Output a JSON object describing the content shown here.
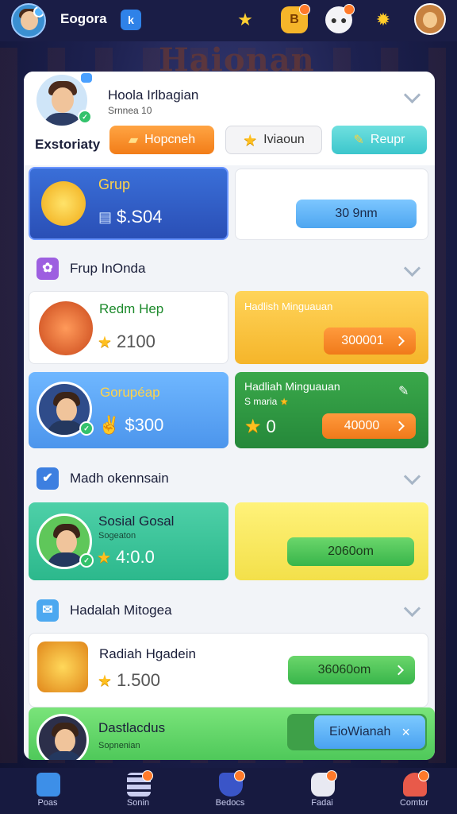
{
  "topbar": {
    "brand": "Eogora",
    "brand_badge": "k",
    "icons": [
      "star-icon",
      "bag-icon",
      "mascot-icon",
      "gear-icon"
    ],
    "accent": "#1a1d46"
  },
  "background_word": "Haionan",
  "profile": {
    "name": "Hoola Irlbagian",
    "subtitle": "Srnnea 10",
    "label": "Exstoriaty",
    "buttons": [
      {
        "label": "Hopcneh",
        "icon": "ticket-icon"
      },
      {
        "label": "Iviaoun",
        "icon": "star-icon"
      },
      {
        "label": "Reupr",
        "icon": "pencil-icon"
      }
    ]
  },
  "group_card": {
    "title": "Grup",
    "amount": "$.S04",
    "side_button": "30 9nm"
  },
  "section1": {
    "title": "Frup InOnda",
    "items": [
      {
        "title": "Redm Hep",
        "value": "2100"
      },
      {
        "title": "Hadlish Minguauan",
        "button": "300001"
      },
      {
        "title": "Gorupéap",
        "amount": "$300"
      },
      {
        "title": "Hadliah Minguauan",
        "sub": "S maria",
        "value": "0",
        "button": "40000"
      }
    ]
  },
  "section2": {
    "title": "Madh okennsain",
    "item": {
      "title": "Sosial Gosal",
      "sub": "Sogeaton",
      "value": "4:0.0",
      "button": "2060om"
    }
  },
  "section3": {
    "title": "Hadalah Mitogea",
    "item": {
      "title": "Radiah Hgadein",
      "value": "1.500",
      "button": "36060om"
    }
  },
  "bottom_card": {
    "title": "Dastlacdus",
    "sub": "Sopnenian",
    "button": "EioWianah",
    "close": "×"
  },
  "bottom_nav": [
    {
      "label": "Poas",
      "icon": "home-icon"
    },
    {
      "label": "Sonin",
      "icon": "grid-icon"
    },
    {
      "label": "Bedocs",
      "icon": "shield-icon"
    },
    {
      "label": "Fadai",
      "icon": "gamepad-icon"
    },
    {
      "label": "Comtor",
      "icon": "user-icon"
    }
  ]
}
